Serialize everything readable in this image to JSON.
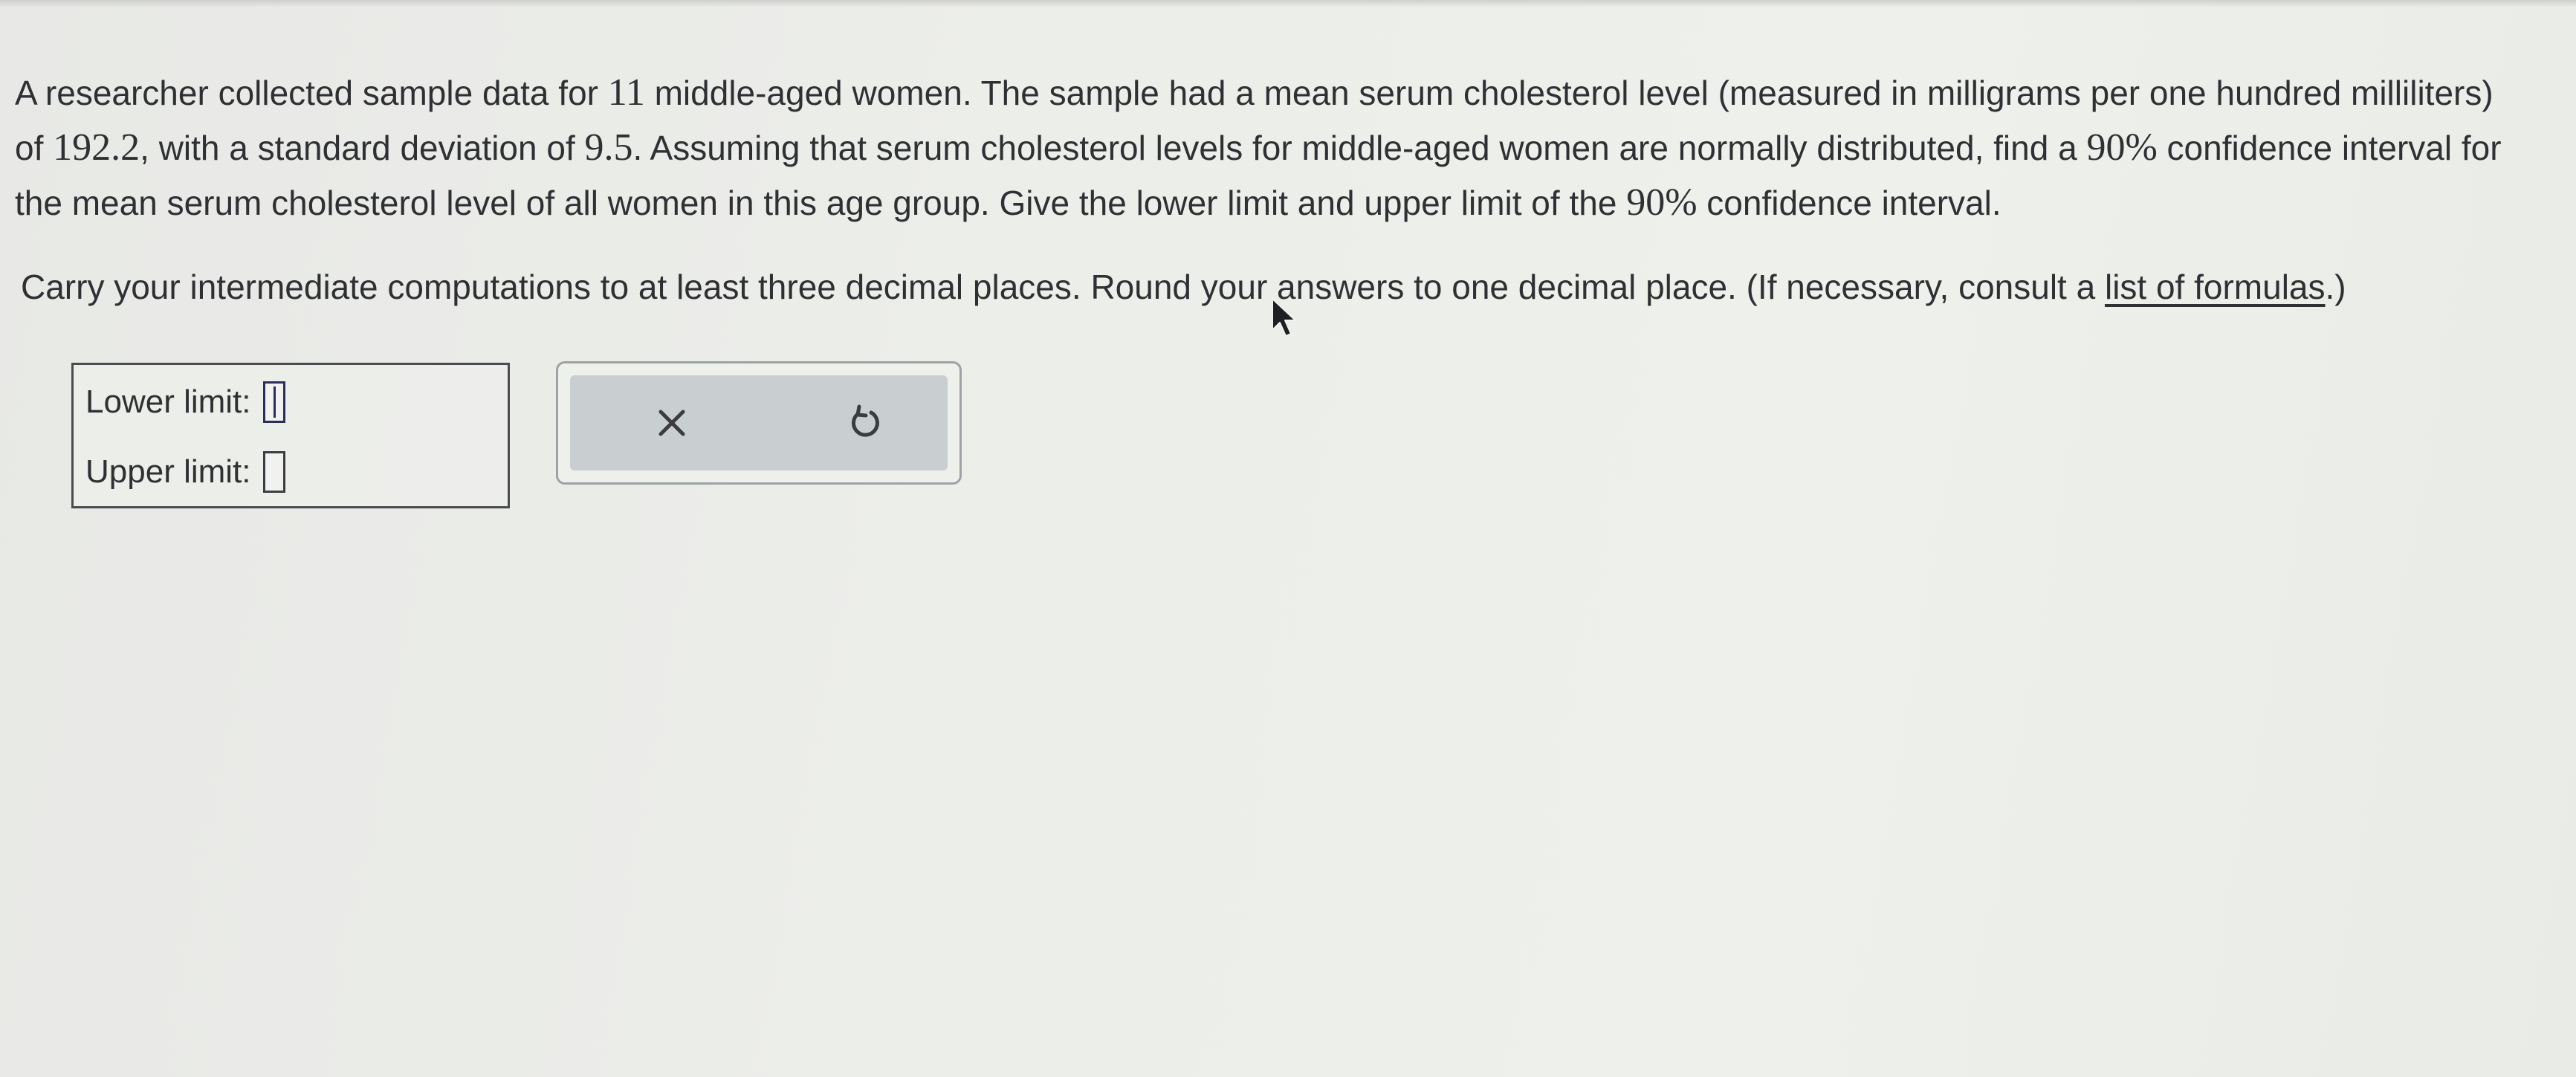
{
  "problem": {
    "part1": "A researcher collected sample data for ",
    "sample_size": "11",
    "part2": " middle-aged women. The sample had a mean serum cholesterol level (measured in milligrams per one hundred milliliters) of ",
    "mean": "192.2",
    "part3": ", with a standard deviation of ",
    "std_dev": "9.5",
    "part4": ". Assuming that serum cholesterol levels for middle-aged women are normally distributed, find a ",
    "confidence1": "90%",
    "part5": " confidence interval for the mean serum cholesterol level of all women in this age group. Give the lower limit and upper limit of the ",
    "confidence2": "90%",
    "part6": " confidence interval."
  },
  "instructions": {
    "text": "Carry your intermediate computations to at least three decimal places. Round your answers to one decimal place. (If necessary, consult a ",
    "link_label": "list of formulas",
    "closing": ".)"
  },
  "answers": {
    "lower_label": "Lower limit:",
    "lower_value": "",
    "upper_label": "Upper limit:",
    "upper_value": ""
  },
  "tools": {
    "clear_icon": "x-icon",
    "undo_icon": "undo-icon"
  }
}
